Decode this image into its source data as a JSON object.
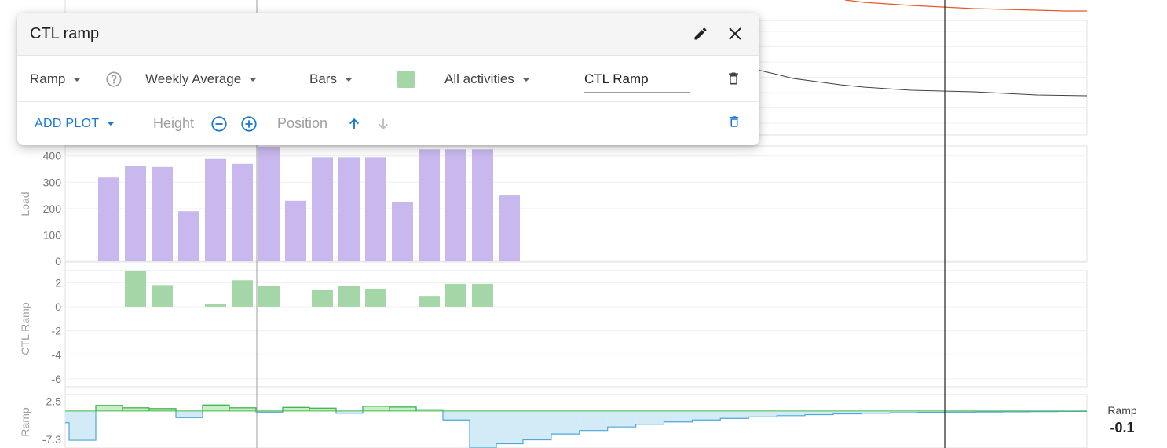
{
  "dialog": {
    "title": "CTL ramp",
    "row1": {
      "metric": "Ramp",
      "aggregation": "Weekly Average",
      "chart_style": "Bars",
      "color": "#a5d6a7",
      "activity_filter": "All activities",
      "plot_name": "CTL Ramp"
    },
    "row2": {
      "add_plot": "ADD PLOT",
      "height_label": "Height",
      "position_label": "Position"
    }
  },
  "icons": {
    "edit": "pencil-icon",
    "close": "close-icon",
    "help": "help-circle-icon",
    "delete": "trash-icon",
    "decrease": "minus-circle-icon",
    "increase": "plus-circle-icon",
    "move_up": "arrow-up-icon",
    "move_down": "arrow-down-icon"
  },
  "colors": {
    "load_bars": "#c9b8ee",
    "ramp_bars": "#a5d6a7",
    "ramp_positive_fill": "#c8efc8",
    "ramp_positive_line": "#43b843",
    "ramp_negative_fill": "#d3eaf7",
    "ramp_negative_line": "#4fa8d8",
    "accent": "#1976d2",
    "top_line_orange": "#e8582a",
    "top_line_dark": "#424242"
  },
  "readout": {
    "label": "Ramp",
    "value": "-0.1"
  },
  "chart_data": [
    {
      "type": "bar",
      "ylabel": "Load",
      "yticks": [
        0,
        100,
        200,
        300,
        400
      ],
      "ylim": [
        0,
        420
      ],
      "values": [
        318,
        362,
        358,
        190,
        388,
        370,
        445,
        230,
        395,
        395,
        395,
        225,
        425,
        425,
        425,
        250
      ]
    },
    {
      "type": "bar",
      "ylabel": "CTL Ramp",
      "yticks": [
        2,
        0,
        -2,
        -4,
        -6
      ],
      "ylim": [
        -6.6,
        3
      ],
      "values": [
        null,
        3.2,
        1.8,
        null,
        0.2,
        2.2,
        1.7,
        null,
        1.4,
        1.7,
        1.5,
        null,
        0.9,
        1.9,
        1.9,
        null
      ]
    },
    {
      "type": "area",
      "ylabel": "Ramp",
      "yticks": [
        "2.5",
        "-7.3"
      ],
      "ylim": [
        -9.5,
        4.2
      ],
      "zero_line": 0,
      "steps": [
        [
          -3,
          -7.5
        ],
        [
          1.4,
          1.4
        ],
        [
          0.8,
          0.8
        ],
        [
          0.6,
          0.6
        ],
        [
          -1.7,
          -1.7
        ],
        [
          1.5,
          1.5
        ],
        [
          0.8,
          0.8
        ],
        [
          -0.3,
          -0.3
        ],
        [
          0.9,
          0.9
        ],
        [
          0.7,
          0.7
        ],
        [
          -0.6,
          -0.6
        ],
        [
          1.2,
          1.2
        ],
        [
          1.0,
          1.0
        ],
        [
          0.3,
          0.3
        ],
        [
          -2.3,
          -2.3
        ],
        [
          -9.5,
          -9.5
        ],
        [
          -8.4,
          -8.4
        ]
      ],
      "decay_tail": [
        -7.4,
        -5.9,
        -5.0,
        -4.1,
        -3.4,
        -2.8,
        -2.3,
        -1.9,
        -1.5,
        -1.2,
        -0.95,
        -0.75,
        -0.6,
        -0.45,
        -0.35,
        -0.3,
        -0.25,
        -0.2,
        -0.15,
        -0.1
      ]
    }
  ]
}
